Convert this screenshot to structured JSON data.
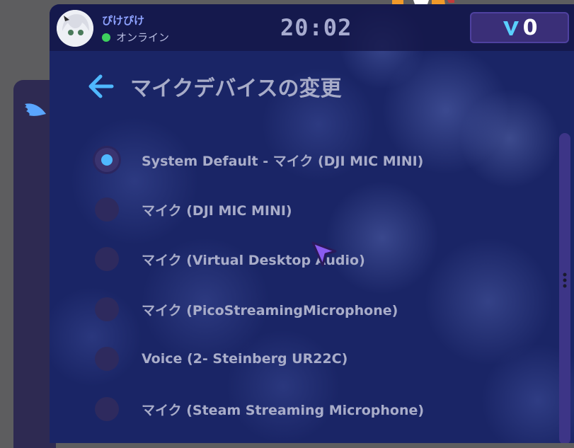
{
  "header": {
    "username": "ぴけぴけ",
    "status": "オンライン",
    "clock": "20:02",
    "balance": "0"
  },
  "page": {
    "title": "マイクデバイスの変更"
  },
  "devices": [
    {
      "label": "System Default - マイク (DJI MIC MINI)",
      "selected": true
    },
    {
      "label": "マイク (DJI MIC MINI)",
      "selected": false
    },
    {
      "label": "マイク (Virtual Desktop Audio)",
      "selected": false
    },
    {
      "label": "マイク (PicoStreamingMicrophone)",
      "selected": false
    },
    {
      "label": "Voice (2- Steinberg UR22C)",
      "selected": false
    },
    {
      "label": "マイク (Steam Streaming Microphone)",
      "selected": false
    }
  ],
  "colors": {
    "background": "#1a2566",
    "accent": "#4fb8ff",
    "online": "#3ed15e",
    "balance_box": "#3a2f78"
  },
  "icons": {
    "back": "arrow-left-icon",
    "sidebar": "wing-icon",
    "currency": "v-currency-icon"
  }
}
